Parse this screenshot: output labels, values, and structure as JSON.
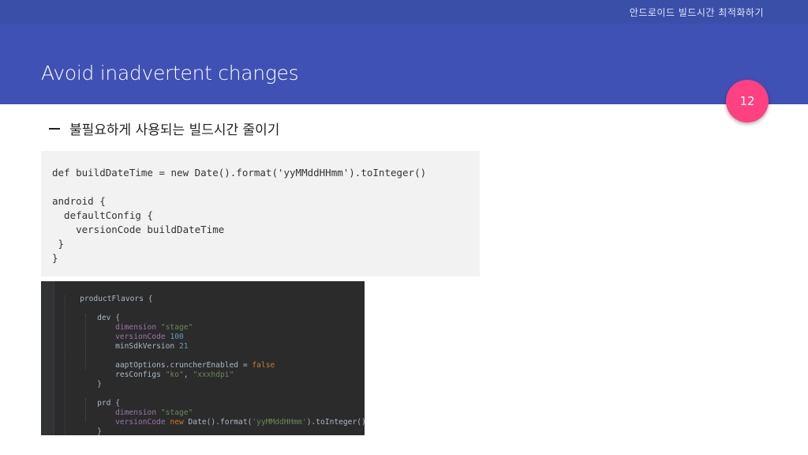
{
  "header": {
    "deck_title": "안드로이드 빌드시간 최적화하기",
    "slide_title": "Avoid inadvertent changes",
    "page_number": "12"
  },
  "bullet": {
    "text": "불필요하게 사용되는 빌드시간 줄이기"
  },
  "code_block": {
    "lines": [
      "def buildDateTime = new Date().format('yyMMddHHmm').toInteger()",
      "",
      "android {",
      "  defaultConfig {",
      "    versionCode buildDateTime",
      " }",
      "}"
    ]
  },
  "ide_code": {
    "l1": "productFlavors {",
    "l2_name": "dev",
    "l2_brace": " {",
    "l3_key": "dimension",
    "l3_val": "\"stage\"",
    "l4_key": "versionCode",
    "l4_val": "100",
    "l5_key": "minSdkVersion",
    "l5_val": "21",
    "l6_key": "aaptOptions.cruncherEnabled = ",
    "l6_val": "false",
    "l7_key": "resConfigs",
    "l7_v1": "\"ko\"",
    "l7_sep": ", ",
    "l7_v2": "\"xxxhdpi\"",
    "l8": "}",
    "l9_name": "prd",
    "l9_brace": " {",
    "l10_key": "dimension",
    "l10_val": "\"stage\"",
    "l11_key": "versionCode ",
    "l11_kw": "new",
    "l11_mid": " Date().format(",
    "l11_str": "'yyMMddHHmm'",
    "l11_end": ").toInteger()",
    "l12": "}"
  },
  "colors": {
    "header_bg": "#3f51b5",
    "badge": "#ff4081",
    "code_bg": "#f2f2f2",
    "ide_bg": "#2b2b2b"
  }
}
